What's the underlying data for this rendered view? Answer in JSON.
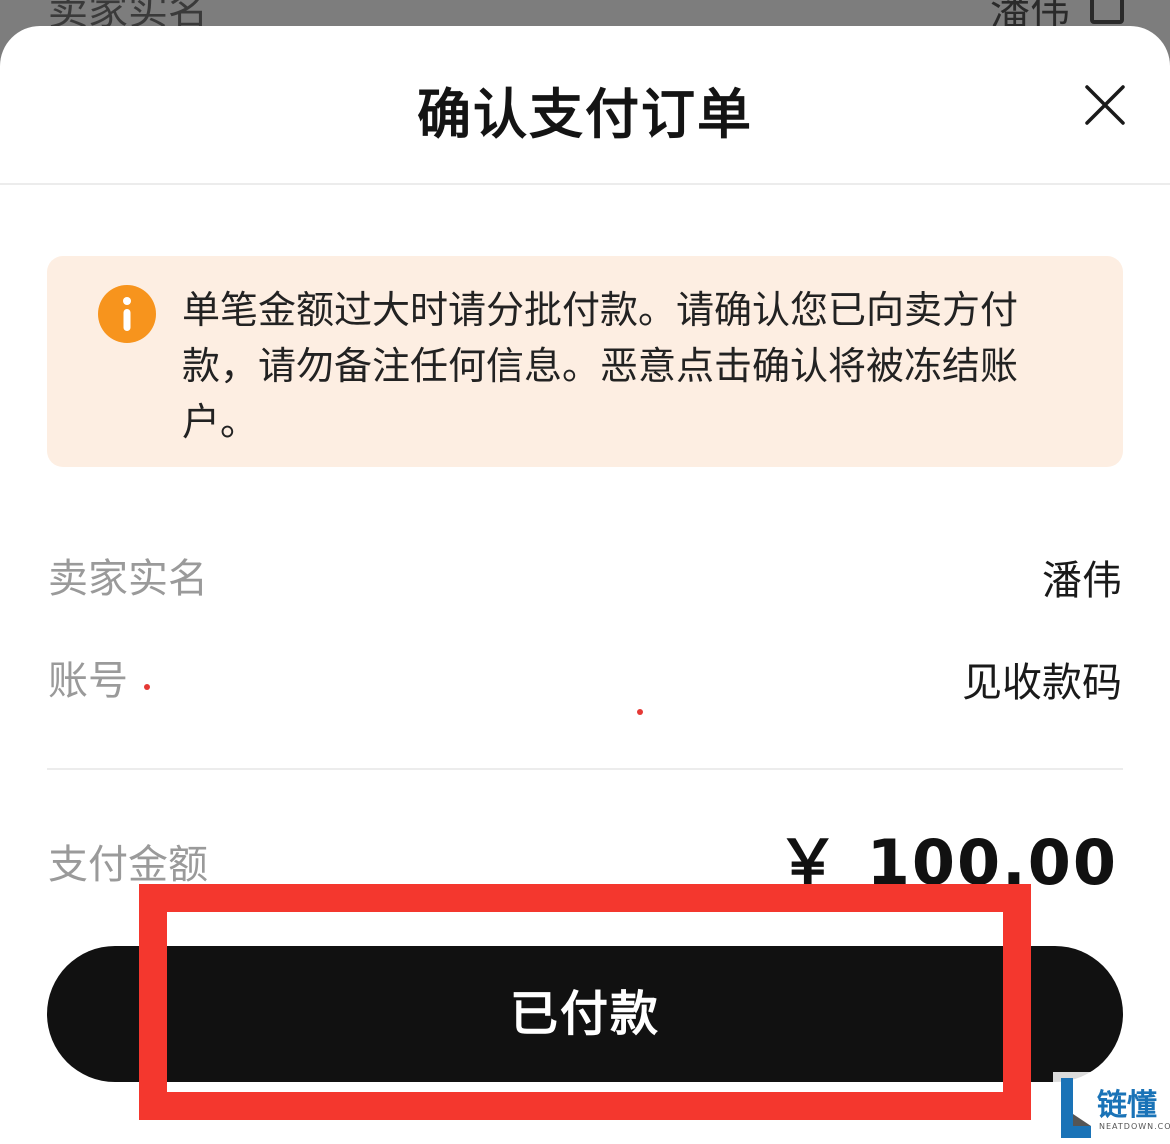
{
  "background": {
    "label": "卖家实名",
    "value": "潘伟"
  },
  "header": {
    "title": "确认支付订单"
  },
  "notice": {
    "text": "单笔金额过大时请分批付款。请确认您已向卖方付款，请勿备注任何信息。恶意点击确认将被冻结账户。",
    "icon": "info-icon",
    "color": "#f7941d"
  },
  "seller": {
    "label": "卖家实名",
    "value": "潘伟"
  },
  "account": {
    "label": "账号",
    "value": "见收款码"
  },
  "amount": {
    "label": "支付金额",
    "currency": "￥",
    "value": "100.00"
  },
  "actions": {
    "paid_label": "已付款"
  },
  "watermark": {
    "name": "链懂",
    "domain": "NEATDOWN.COM"
  },
  "colors": {
    "button": "#111111",
    "notice_bg": "#fdeee2",
    "highlight": "#f4372e"
  }
}
